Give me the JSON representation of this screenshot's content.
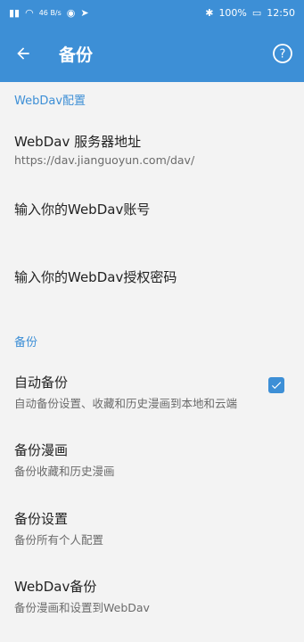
{
  "status_bar": {
    "left_icons": [
      "sim-signal-icon",
      "wifi-icon",
      "eye-icon",
      "send-icon"
    ],
    "network_rate": "46 B/s",
    "battery": "100%",
    "time": "12:50"
  },
  "app_bar": {
    "title": "备份"
  },
  "sections": {
    "webdav": {
      "header": "WebDav配置",
      "server": {
        "title": "WebDav 服务器地址",
        "subtitle": "https://dav.jianguoyun.com/dav/"
      },
      "account": {
        "title": "输入你的WebDav账号"
      },
      "password": {
        "title": "输入你的WebDav授权密码"
      }
    },
    "backup": {
      "header": "备份",
      "auto": {
        "title": "自动备份",
        "subtitle": "自动备份设置、收藏和历史漫画到本地和云端",
        "checked": true
      },
      "comics": {
        "title": "备份漫画",
        "subtitle": "备份收藏和历史漫画"
      },
      "settings": {
        "title": "备份设置",
        "subtitle": "备份所有个人配置"
      },
      "webdav_backup": {
        "title": "WebDav备份",
        "subtitle": "备份漫画和设置到WebDav"
      }
    }
  },
  "colors": {
    "accent": "#3d8fd6",
    "background": "#f3f3f3"
  }
}
